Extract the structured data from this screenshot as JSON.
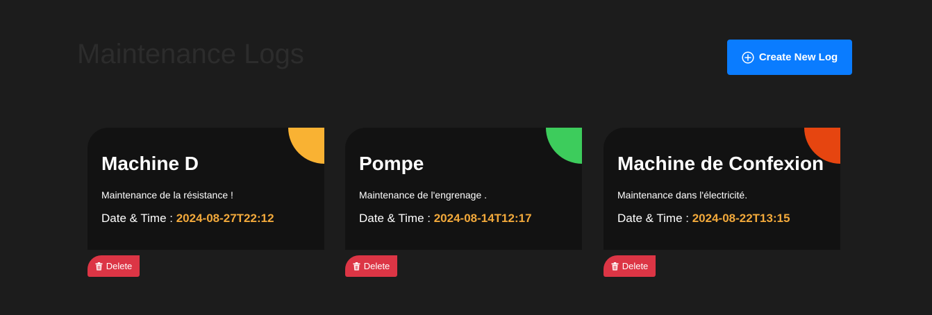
{
  "header": {
    "title": "Maintenance Logs",
    "create_button_label": "Create New Log",
    "create_button_icon": "plus-circle-icon"
  },
  "colors": {
    "background": "#1c1c1c",
    "card_background": "#121212",
    "primary": "#0a7cff",
    "danger": "#dc3545",
    "date_accent": "#f2a93b"
  },
  "logs": [
    {
      "machine": "Machine D",
      "description": "Maintenance de la résistance !",
      "date_label": "Date & Time :",
      "datetime": "2024-08-27T22:12",
      "status_color": "#f9b233",
      "delete_label": "Delete",
      "delete_icon": "trash-icon"
    },
    {
      "machine": "Pompe",
      "description": "Maintenance de l'engrenage .",
      "date_label": "Date & Time :",
      "datetime": "2024-08-14T12:17",
      "status_color": "#3dcc5c",
      "delete_label": "Delete",
      "delete_icon": "trash-icon"
    },
    {
      "machine": "Machine de Confexion",
      "description": "Maintenance dans l'électricité.",
      "date_label": "Date & Time :",
      "datetime": "2024-08-22T13:15",
      "status_color": "#e64510",
      "delete_label": "Delete",
      "delete_icon": "trash-icon"
    }
  ]
}
